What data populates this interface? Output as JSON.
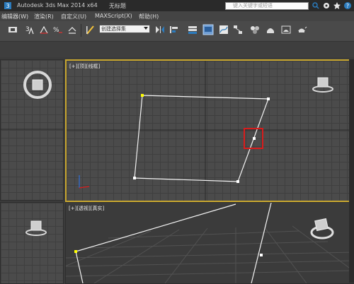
{
  "window": {
    "app_title": "Autodesk 3ds Max  2014 x64",
    "doc_title": "无标题",
    "search_placeholder": "键入关键字或短语"
  },
  "menu": {
    "items": [
      "编辑器(W)",
      "渲染(R)",
      "自定义(U)",
      "MAXScript(X)",
      "帮助(H)"
    ]
  },
  "toolbar": {
    "selection_set_value": "创建选择集"
  },
  "viewports": {
    "top": {
      "label": "[+][顶][线框]"
    },
    "perspective": {
      "label": "[+][透视][真实]"
    }
  },
  "colors": {
    "active_viewport_border": "#c9a830",
    "selection_highlight": "#d81c1c",
    "grid": "#3f3f3f",
    "spline": "#ffffff",
    "first_vertex": "#ffff00"
  }
}
